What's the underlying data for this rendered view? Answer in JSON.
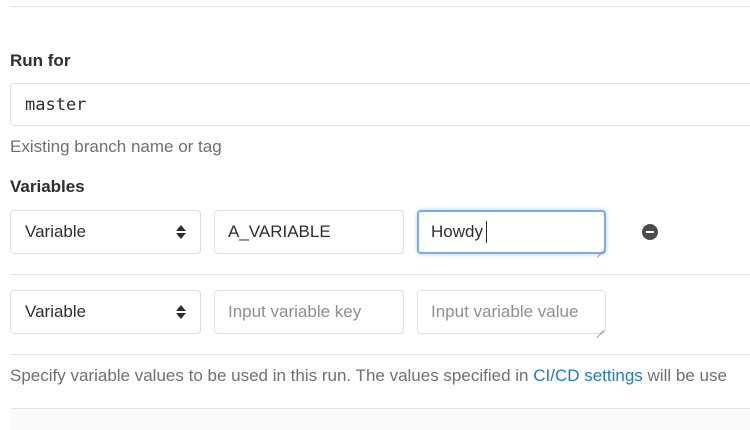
{
  "run_for": {
    "label": "Run for",
    "ref_value": "master",
    "help": "Existing branch name or tag"
  },
  "variables": {
    "label": "Variables",
    "rows": [
      {
        "type": "Variable",
        "key": "A_VARIABLE",
        "value": "Howdy",
        "remove_icon": "minus-circle-icon"
      },
      {
        "type": "Variable",
        "key": "",
        "key_placeholder": "Input variable key",
        "value": "",
        "value_placeholder": "Input variable value"
      }
    ],
    "help_prefix": "Specify variable values to be used in this run. The values specified in ",
    "help_link": "CI/CD settings",
    "help_suffix": " will be use"
  },
  "colors": {
    "link": "#1f78d1",
    "focus_border": "#73afea",
    "help_text": "#707070"
  }
}
